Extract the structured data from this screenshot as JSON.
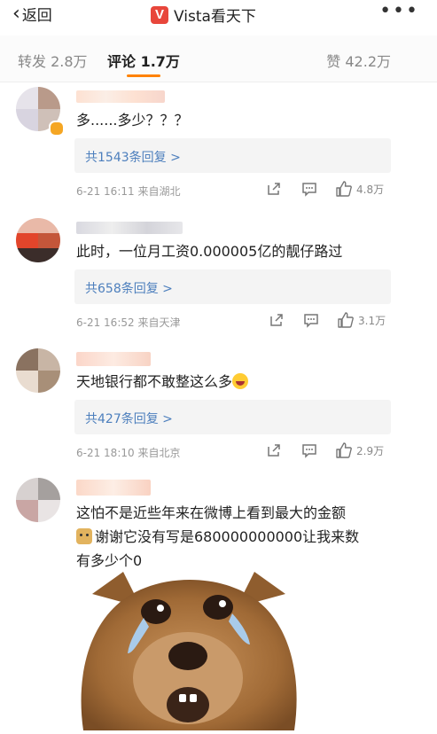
{
  "nav": {
    "back_label": "返回",
    "title": "Vista看天下",
    "logo_letter": "V",
    "more_icon": "more-dots-icon"
  },
  "tabs": {
    "repost": "转发 2.8万",
    "comment": "评论 1.7万",
    "like": "赞 42.2万",
    "active": "comment",
    "accent": "#ff8200"
  },
  "comments": [
    {
      "text": "多......多少？？？",
      "replies": "共1543条回复 >",
      "time": "6-21 16:11  来自湖北",
      "likes": "4.8万"
    },
    {
      "text": "此时，一位月工资0.000005亿的靓仔路过",
      "replies": "共658条回复 >",
      "time": "6-21 16:52  来自天津",
      "likes": "3.1万"
    },
    {
      "text": "天地银行都不敢整这么多",
      "replies": "共427条回复 >",
      "time": "6-21 18:10  来自北京",
      "likes": "2.9万"
    },
    {
      "text_line1": "这怕不是近些年来在微博上看到最大的金额",
      "text_line2": "谢谢它没有写是680000000000让我来数",
      "text_line3": "有多少个0"
    }
  ],
  "colors": {
    "link_blue": "#4d7fbd",
    "reply_bg": "#f4f4f4",
    "meta_gray": "#999999"
  }
}
